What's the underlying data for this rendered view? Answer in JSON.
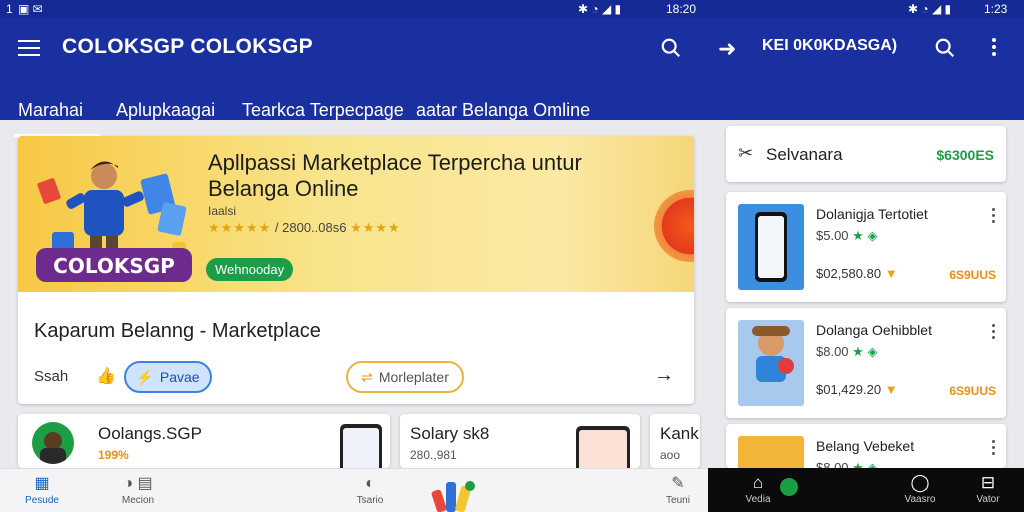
{
  "status_bar": {
    "left_icons": [
      "sim-icon",
      "notification-icon",
      "message-icon"
    ],
    "left_text": "1",
    "time_center": "18:20",
    "time_right": "1:23"
  },
  "app_bar": {
    "title": "COLOKSGP  COLOKSGP",
    "account_label": "KEI 0K0KDASGA)"
  },
  "tabs": [
    {
      "label": "Marahai",
      "active": true
    },
    {
      "label": "Aplupkaagai",
      "active": false
    },
    {
      "label": "Tearkca Terpecpage",
      "active": false
    },
    {
      "label": "aatar Belanga Omline",
      "active": false
    }
  ],
  "hero": {
    "title": "Apllpassi Marketplace Terpercha untur Belanga Online",
    "sub": "Iaalsi",
    "rating_stars": "★★★★★",
    "rating_text": "/ 2800..08s6",
    "rating_stars_2": "★★★★",
    "chip": "Wehnooday",
    "brand": "COLOKSGP",
    "name": "Kaparum Belanng - Marketplace",
    "sign": "Ssah",
    "primary_button": "Pavae",
    "outline_button": "Morleplater",
    "accent_color": "#1b9e46"
  },
  "mini_cards": [
    {
      "title": "Oolangs.SGP",
      "sub": "199%"
    },
    {
      "title": "Solary sk8",
      "sub": "280.,981"
    },
    {
      "title": "Kank",
      "sub": "aoo"
    }
  ],
  "side_header": {
    "label": "Selvanara",
    "value": "$6300ES"
  },
  "products": [
    {
      "title": "Dolanigja Tertotiet",
      "price": "$5.00",
      "orig": "$02,580.80",
      "sold": "6S9UUS"
    },
    {
      "title": "Dolanga Oehibblet",
      "price": "$8.00",
      "orig": "$01,429.20",
      "sold": "6S9UUS"
    },
    {
      "title": "Belang Vebeket",
      "price": "$8.00",
      "orig": "",
      "sold": ""
    }
  ],
  "bottom_nav": [
    {
      "label": "Pesude",
      "icon": "grid-icon",
      "active": true
    },
    {
      "label": "Mecion",
      "icon": "list-icon",
      "active": false
    },
    {
      "label": "Tsario",
      "icon": "leaf-icon",
      "active": false
    },
    {
      "label": "Teuni",
      "icon": "edit-icon",
      "active": false
    }
  ],
  "bottom_nav_dark": [
    {
      "label": "Vedia",
      "icon": "home-icon"
    },
    {
      "label": "Vaasro",
      "icon": "chat-icon"
    },
    {
      "label": "Vator",
      "icon": "store-icon"
    }
  ]
}
